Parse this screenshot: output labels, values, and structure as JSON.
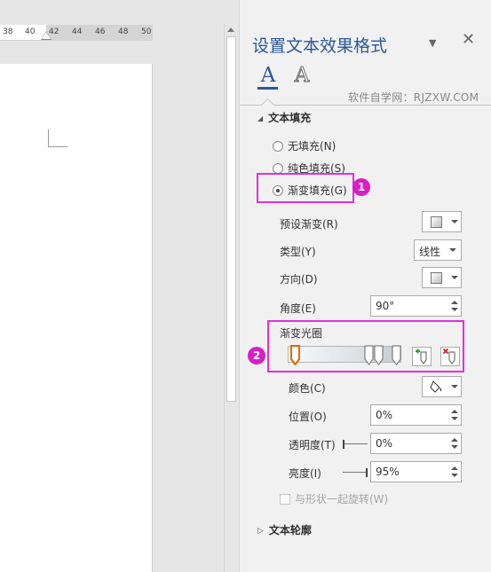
{
  "ruler": {
    "ticks": [
      "38",
      "40",
      "42",
      "44",
      "46",
      "48",
      "50"
    ]
  },
  "pane": {
    "title": "设置文本效果格式",
    "tabs": [
      {
        "name": "text-fill-outline",
        "glyph": "A"
      },
      {
        "name": "text-effects",
        "glyph": "A"
      }
    ],
    "watermark": "软件自学网：RJZXW.COM"
  },
  "fill_section": {
    "title": "文本填充",
    "options": [
      {
        "label": "无填充(N)",
        "checked": false
      },
      {
        "label": "纯色填充(S)",
        "checked": false
      },
      {
        "label": "渐变填充(G)",
        "checked": true
      }
    ],
    "preset_label": "预设渐变(R)",
    "type_label": "类型(Y)",
    "type_value": "线性",
    "direction_label": "方向(D)",
    "angle_label": "角度(E)",
    "angle_value": "90°",
    "stops_label": "渐变光圈",
    "color_label": "颜色(C)",
    "position_label": "位置(O)",
    "position_value": "0%",
    "transparency_label": "透明度(T)",
    "transparency_value": "0%",
    "brightness_label": "亮度(I)",
    "brightness_value": "95%",
    "rotate_label": "与形状一起旋转(W)",
    "rotate_checked": false
  },
  "outline_section": {
    "title": "文本轮廓"
  },
  "badges": [
    "1",
    "2"
  ],
  "colors": {
    "accent": "#2b579a",
    "highlight": "#e22ee0",
    "badge": "#d81ec7"
  }
}
